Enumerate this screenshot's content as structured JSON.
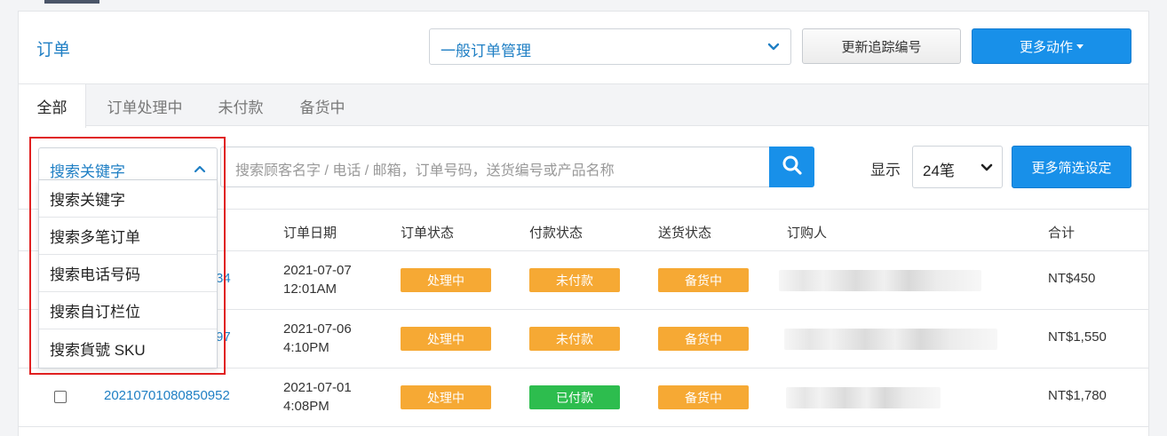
{
  "header": {
    "title": "订单",
    "mode_select": "一般订单管理",
    "tracking_button": "更新追踪编号",
    "more_actions_button": "更多动作"
  },
  "tabs": [
    "全部",
    "订单处理中",
    "未付款",
    "备货中"
  ],
  "search": {
    "keyword_selected": "搜索关键字",
    "keyword_options": [
      "搜索关键字",
      "搜索多笔订单",
      "搜索电话号码",
      "搜索自订栏位",
      "搜索貨號 SKU"
    ],
    "placeholder": "搜索顾客名字 / 电话 / 邮箱，订单号码，送货编号或产品名称",
    "show_label": "显示",
    "page_size": "24笔",
    "filter_button": "更多筛选设定"
  },
  "table": {
    "headers": [
      "订单日期",
      "订单状态",
      "付款状态",
      "送货状态",
      "订购人",
      "合计"
    ],
    "rows": [
      {
        "order_no": "34",
        "date": "2021-07-07",
        "time": "12:01AM",
        "order_status": "处理中",
        "payment_status": "未付款",
        "delivery_status": "备货中",
        "total": "NT$450"
      },
      {
        "order_no": "97",
        "date": "2021-07-06",
        "time": "4:10PM",
        "order_status": "处理中",
        "payment_status": "未付款",
        "delivery_status": "备货中",
        "total": "NT$1,550"
      },
      {
        "order_no": "20210701080850952",
        "date": "2021-07-01",
        "time": "4:08PM",
        "order_status": "处理中",
        "payment_status": "已付款",
        "delivery_status": "备货中",
        "total": "NT$1,780"
      }
    ]
  },
  "colors": {
    "accent": "#1890e9",
    "link": "#1f7fc4",
    "status_orange": "#f6a934",
    "status_green": "#2dbd4e",
    "highlight": "#e02020"
  },
  "icons": [
    "chevron-down-icon",
    "chevron-up-icon",
    "search-icon",
    "caret-down-icon"
  ]
}
